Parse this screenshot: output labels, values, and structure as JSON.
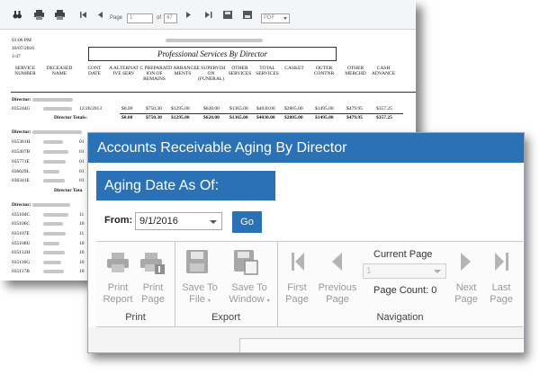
{
  "report": {
    "toolbar": {
      "page_label": "Page",
      "page_value": "1",
      "of_label": "of",
      "page_total": "47",
      "format_value": "PDF"
    },
    "header_left": [
      "01:06 PM",
      "10/07/2016",
      "1/47"
    ],
    "title": "Professional Services By Director",
    "columns": [
      "SERVICE NUMBER",
      "DECEASED NAME",
      "CONT DATE",
      "A ALTERNAT IVE SERV",
      "C PREPARAT ION OF REMAINS",
      "D ARRANGE MENTS",
      "E SUPERVISI ON (FUNERAL)",
      "OTHER SERVICES",
      "TOTAL SERVICES",
      "CASKET",
      "OUTER CONTNR",
      "OTHER MERCHD",
      "CASH ADVANCE"
    ],
    "director_label": "Director:",
    "director_totals_label": "Director Totals:",
    "first_row": {
      "number": "035244G",
      "date": "12/26/2013",
      "values": [
        "$0.00",
        "$750.30",
        "$1295.00",
        "$620.00",
        "$1365.00",
        "$4030.00",
        "$2805.00",
        "$1495.00",
        "$479.95",
        "$357.25"
      ]
    },
    "totals_row": [
      "$0.00",
      "$750.30",
      "$1295.00",
      "$620.00",
      "$1365.00",
      "$4030.00",
      "$2805.00",
      "$1495.00",
      "$479.95",
      "$357.25"
    ],
    "second_block_numbers": [
      "035381H",
      "035407B",
      "035771E",
      "036029L",
      "036341E"
    ],
    "second_block_dates": [
      "01",
      "01",
      "01",
      "01",
      "01"
    ],
    "director_totals_label_2": "Director Tota",
    "third_block_numbers": [
      "035104C",
      "035106C",
      "035107E",
      "035108U",
      "035112H",
      "035116G",
      "035117B"
    ],
    "third_block_dates": [
      "11",
      "10",
      "11",
      "10",
      "10",
      "10",
      "10"
    ]
  },
  "aging": {
    "window_title": "Accounts Receivable Aging By Director",
    "date_heading": "Aging Date As Of:",
    "from_label": "From:",
    "from_value": "9/1/2016",
    "go_label": "Go",
    "ribbon": {
      "print_report": "Print Report",
      "print_page": "Print Page",
      "save_to_file": "Save To File",
      "save_to_window": "Save To Window",
      "first_page": "First Page",
      "previous_page": "Previous Page",
      "current_page_label": "Current Page",
      "current_page_value": "1",
      "page_count": "Page Count: 0",
      "next_page": "Next Page",
      "last_page": "Last Page",
      "group_print": "Print",
      "group_export": "Export",
      "group_navigation": "Navigation"
    }
  },
  "colors": {
    "accent_blue": "#2a72b5",
    "disabled_gray": "#9a9a9a"
  }
}
